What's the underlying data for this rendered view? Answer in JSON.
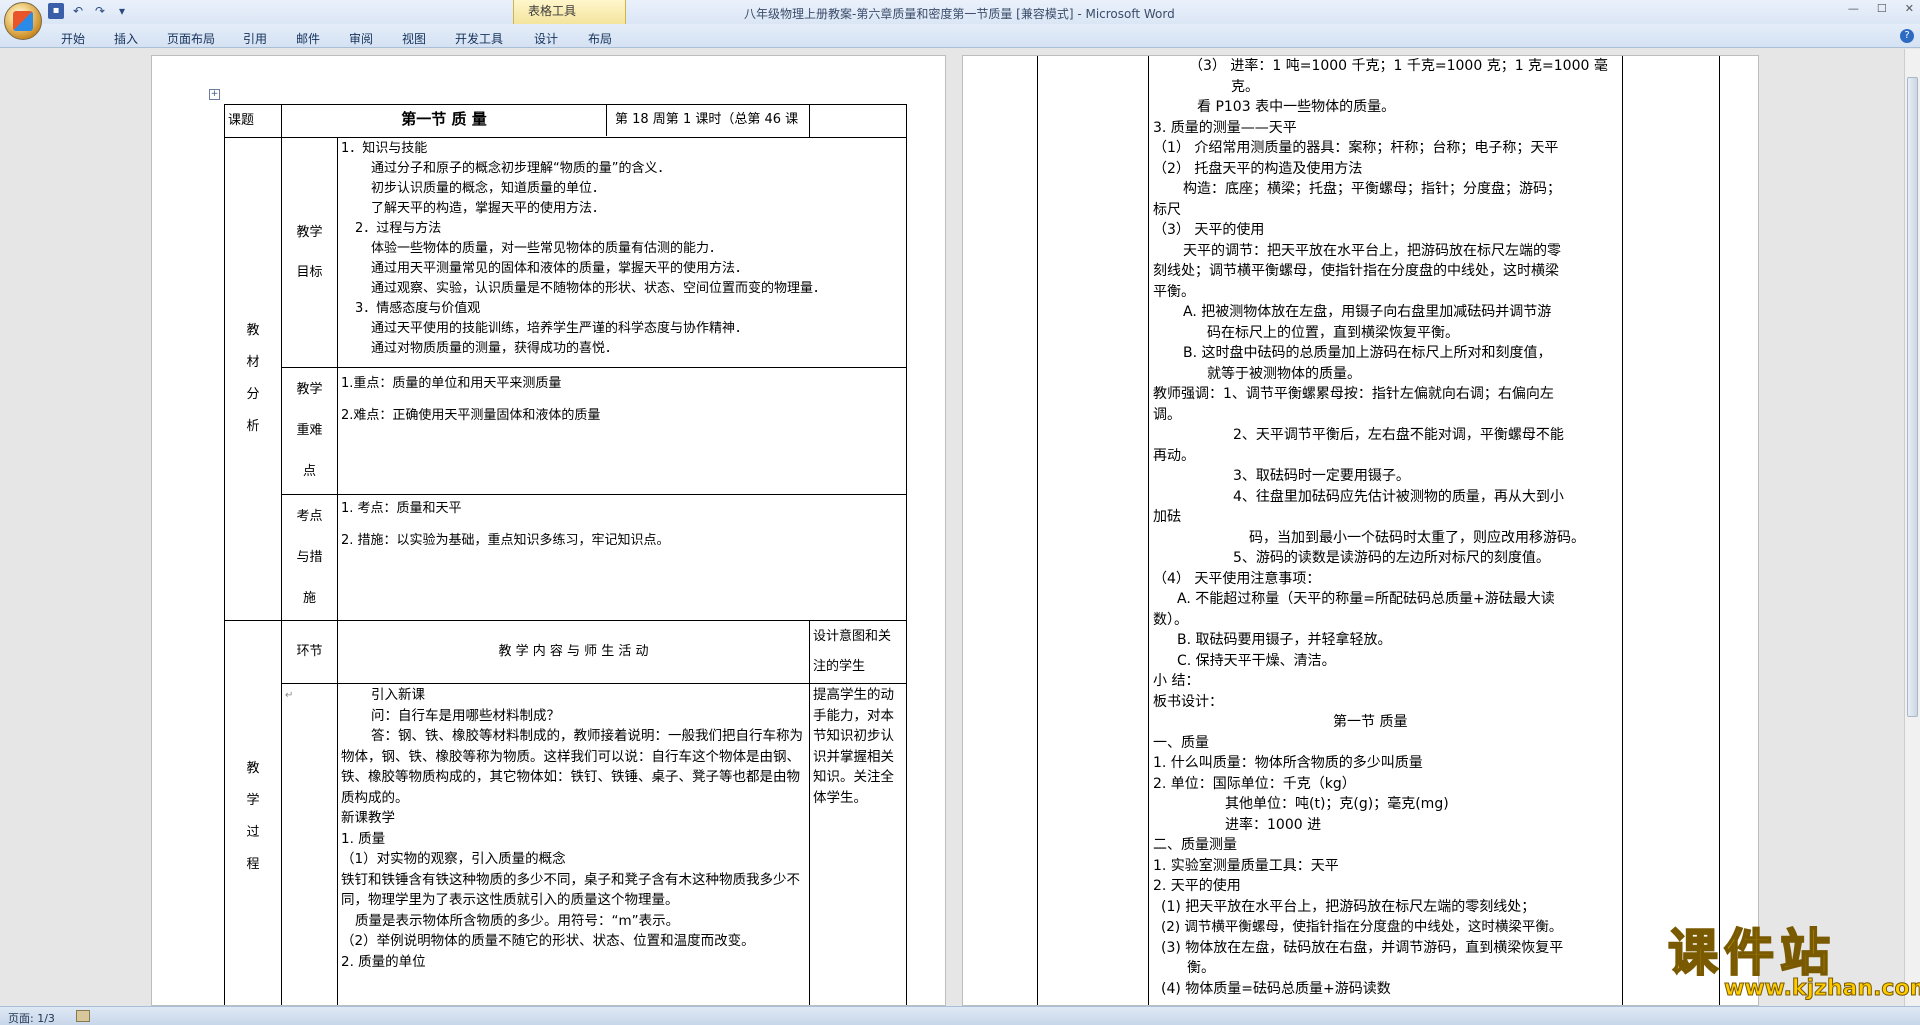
{
  "app": {
    "title": "八年级物理上册教案-第六章质量和密度第一节质量 [兼容模式] - Microsoft Word",
    "contextual_tab_group": "表格工具",
    "tabs": [
      "开始",
      "插入",
      "页面布局",
      "引用",
      "邮件",
      "审阅",
      "视图",
      "开发工具",
      "设计",
      "布局"
    ],
    "window_controls": [
      "—",
      "☐",
      "✕"
    ]
  },
  "status": {
    "page": "页面: 1/3"
  },
  "watermark": {
    "text": "课件站",
    "url": "www.kjzhan.com"
  },
  "page1": {
    "row1": {
      "label": "课题",
      "title": "第一节  质  量",
      "week": "第 18 周第 1 课时（总第 46 课时）"
    },
    "section_a": "教材分析",
    "goals_label": "教学目标",
    "goals": [
      "1．知识与技能",
      "通过分子和原子的概念初步理解“物质的量”的含义．",
      "初步认识质量的概念，知道质量的单位．",
      "了解天平的构造，掌握天平的使用方法．",
      "2．过程与方法",
      "体验一些物体的质量，对一些常见物体的质量有估测的能力．",
      "通过用天平测量常见的固体和液体的质量，掌握天平的使用方法．",
      "通过观察、实验，认识质量是不随物体的形状、状态、空间位置而变的物理量．",
      "3．情感态度与价值观",
      "通过天平使用的技能训练，培养学生严谨的科学态度与协作精神．",
      "通过对物质质量的测量，获得成功的喜悦．"
    ],
    "key_label": "教学重难点",
    "key_points": [
      "1.重点：质量的单位和用天平来测质量",
      "2.难点：正确使用天平测量固体和液体的质量"
    ],
    "exam_label": "考点与措施",
    "exam": [
      "1. 考点：质量和天平",
      "2. 措施：以实验为基础，重点知识多练习，牢记知识点。"
    ],
    "section_b": "教学过程",
    "stage_label": "环节",
    "content_header": "教 学 内 容 与 师 生 活 动",
    "design_header": "设计意图和关注的学生",
    "design_text": "提高学生的动手能力，对本节知识初步认识并掌握相关知识。关注全体学生。",
    "content": [
      "引入新课",
      "问：自行车是用哪些材料制成？",
      "答：钢、铁、橡胶等材料制成的，教师接着说明：一般我们把自行车称为物体，钢、铁、橡胶等称为物质。这样我们可以说：自行车这个物体是由钢、铁、橡胶等物质构成的，其它物体如：铁钉、铁锤、桌子、凳子等也都是由物质构成的。",
      "新课教学",
      "1. 质量",
      "（1）对实物的观察，引入质量的概念",
      "铁钉和铁锤含有铁这种物质的多少不同，桌子和凳子含有木这种物质我多少不同，物理学里为了表示这性质就引入的质量这个物理量。",
      "质量是表示物体所含物质的多少。用符号：“m”表示。",
      "（2）举例说明物体的质量不随它的形状、状态、位置和温度而改变。",
      "2. 质量的单位"
    ]
  },
  "page2": {
    "lines": [
      "（3）  进率：1 吨=1000 千克；1 千克=1000 克；1 克=1000 毫",
      "克。",
      "看 P103 表中一些物体的质量。",
      "3. 质量的测量——天平",
      "（1） 介绍常用测质量的器具：案称；杆称；台称；电子称；天平",
      "（2） 托盘天平的构造及使用方法",
      "构造：底座；横梁；托盘；平衡螺母；指针；分度盘；游码；",
      "标尺",
      "（3） 天平的使用",
      "天平的调节：把天平放在水平台上，把游码放在标尺左端的零",
      "刻线处；调节横平衡螺母，使指针指在分度盘的中线处，这时横梁",
      "平衡。",
      "A. 把被测物体放在左盘，用镊子向右盘里加减砝码并调节游",
      "码在标尺上的位置，直到横梁恢复平衡。",
      "B. 这时盘中砝码的总质量加上游码在标尺上所对和刻度值，",
      "就等于被测物体的质量。",
      "教师强调：1、调节平衡螺累母按：指针左偏就向右调；右偏向左",
      "调。",
      "2、天平调节平衡后，左右盘不能对调，平衡螺母不能",
      "再动。",
      "3、取砝码时一定要用镊子。",
      "4、往盘里加砝码应先估计被测物的质量，再从大到小",
      "加砝",
      "码，当加到最小一个砝码时太重了，则应改用移游码。",
      "5、游码的读数是读游码的左边所对标尺的刻度值。",
      "（4） 天平使用注意事项：",
      "A. 不能超过称量（天平的称量=所配砝码总质量+游砝最大读",
      "数）。",
      "B. 取砝码要用镊子，并轻拿轻放。",
      "C. 保持天平干燥、清洁。",
      "小    结：",
      "板书设计：",
      "第一节 质量",
      "一、质量",
      "1. 什么叫质量：物体所含物质的多少叫质量",
      "2. 单位：国际单位：千克（kg）",
      "其他单位：吨(t)；克(g)；毫克(mg)",
      "进率：1000 进",
      "二、质量测量",
      "1. 实验室测量质量工具：天平",
      "2. 天平的使用",
      "(1) 把天平放在水平台上，把游码放在标尺左端的零刻线处；",
      "(2) 调节横平衡螺母，使指针指在分度盘的中线处，这时横梁平衡。",
      "(3) 物体放在左盘，砝码放在右盘，并调节游码，直到横梁恢复平",
      "衡。",
      "(4) 物体质量=砝码总质量+游码读数"
    ]
  }
}
